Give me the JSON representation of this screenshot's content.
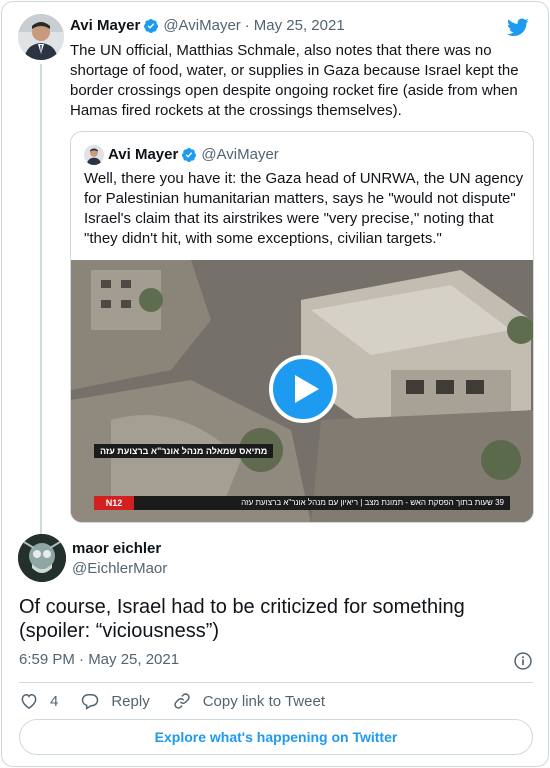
{
  "colors": {
    "brand_blue": "#1d9bf0",
    "text_primary": "#0f1419",
    "text_muted": "#536471",
    "border": "#cfd9de"
  },
  "tweet": {
    "author_name": "Avi Mayer",
    "author_handle": "@AviMayer",
    "separator": "·",
    "date": "May 25, 2021",
    "verified_icon": "verified-badge-icon",
    "text": "The UN official, Matthias Schmale, also notes that there was no shortage of food, water, or supplies in Gaza because Israel kept the border crossings open despite ongoing rocket fire (aside from when Hamas fired rockets at the crossings themselves)."
  },
  "quoted_tweet": {
    "author_name": "Avi Mayer",
    "author_handle": "@AviMayer",
    "text": "Well, there you have it: the Gaza head of UNRWA, the UN agency for Palestinian humanitarian matters, says he \"would not dispute\" Israel's claim that its airstrikes were \"very precise,\" noting that \"they didn't hit, with some exceptions, civilian targets.\"",
    "video": {
      "overlay_caption": "מתיאס שמאלה מנהל אונר\"א ברצועת עזה",
      "ticker_channel": "N12",
      "ticker_text": "39 שעות בתוך הפסקת האש - תמונת מצב | ריאיון עם מנהל אונר\"א ברצועת עזה"
    }
  },
  "reply": {
    "author_name": "maor eichler",
    "author_handle": "@EichlerMaor",
    "text": "Of course, Israel had to be criticized for something (spoiler: “viciousness”)",
    "timestamp": "6:59 PM · May 25, 2021"
  },
  "actions": {
    "like_count": "4",
    "reply_label": "Reply",
    "copy_link_label": "Copy link to Tweet"
  },
  "footer": {
    "explore_label": "Explore what's happening on Twitter"
  }
}
